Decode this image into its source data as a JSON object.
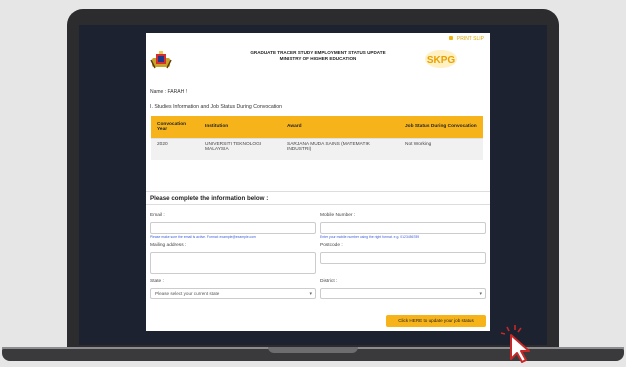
{
  "header": {
    "print_label": "PRINT SLIP",
    "title_line1": "GRADUATE TRACER STUDY EMPLOYMENT STATUS UPDATE",
    "title_line2": "MINISTRY OF HIGHER EDUCATION",
    "logo_text": "SKPG"
  },
  "profile": {
    "name": "Name : FARAH !"
  },
  "section_title": "I. Studies Information and Job Status During Convocation",
  "table": {
    "headers": [
      "Convocation Year",
      "Institution",
      "Award",
      "Job Status During Convocation"
    ],
    "rows": [
      [
        "2020",
        "UNIVERSITI TEKNOLOGI MALAYSIA",
        "SARJANA MUDA SAINS (MATEMATIK INDUSTRI)",
        "Not Working"
      ]
    ]
  },
  "form": {
    "heading": "Please complete the information below :",
    "email_label": "Email :",
    "email_value": "",
    "email_hint": "Please make sure the email is active. Format: example@example.com",
    "mobile_label": "Mobile Number :",
    "mobile_value": "",
    "mobile_hint": "Enter your mobile number using the right format. e.g. 0123456789",
    "address_label": "Mailing address :",
    "postcode_label": "Postcode :",
    "state_label": "State :",
    "state_placeholder": "Please select your current state",
    "district_label": "District :",
    "district_value": "",
    "submit_label": "Click HERE to update your job status"
  }
}
